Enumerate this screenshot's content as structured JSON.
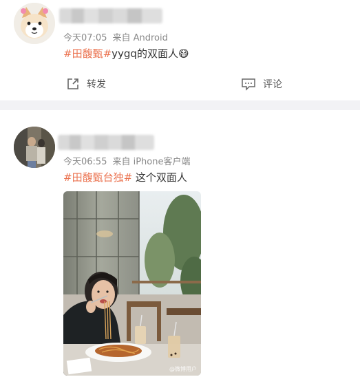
{
  "posts": [
    {
      "time": "今天07:05",
      "source": "来自 Android",
      "hashtag": "#田馥甄#",
      "text": "yygq的双面人",
      "emoji": "😷",
      "actions": {
        "repost": "转发",
        "comment": "评论"
      }
    },
    {
      "time": "今天06:55",
      "source": "来自 iPhone客户端",
      "hashtag": "#田馥甄台独#",
      "text": " 这个双面人",
      "watermark": "@微博用户"
    }
  ],
  "colors": {
    "hashtag": "#eb7350",
    "meta": "#888888",
    "background": "#f2f2f5"
  }
}
